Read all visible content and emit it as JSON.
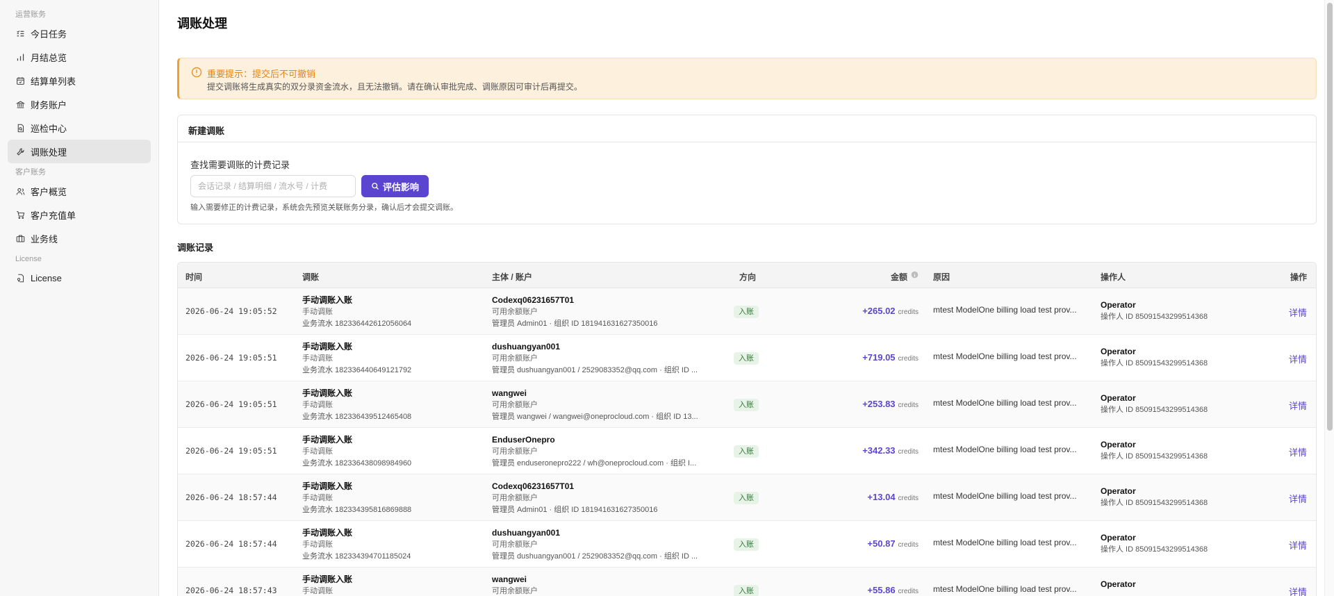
{
  "sidebar": {
    "groups": [
      {
        "label": "运营账务",
        "items": [
          {
            "label": "今日任务",
            "icon": "list-check-icon"
          },
          {
            "label": "月结总览",
            "icon": "bar-chart-icon"
          },
          {
            "label": "结算单列表",
            "icon": "calendar-icon"
          },
          {
            "label": "财务账户",
            "icon": "bank-icon"
          },
          {
            "label": "巡检中心",
            "icon": "file-search-icon"
          },
          {
            "label": "调账处理",
            "icon": "wrench-icon",
            "active": true
          }
        ]
      },
      {
        "label": "客户账务",
        "items": [
          {
            "label": "客户概览",
            "icon": "users-icon"
          },
          {
            "label": "客户充值单",
            "icon": "cart-icon"
          },
          {
            "label": "业务线",
            "icon": "briefcase-icon"
          }
        ]
      },
      {
        "label": "License",
        "items": [
          {
            "label": "License",
            "icon": "file-key-icon"
          }
        ]
      }
    ]
  },
  "page": {
    "title": "调账处理"
  },
  "warning": {
    "title": "重要提示：提交后不可撤销",
    "text": "提交调账将生成真实的双分录资金流水，且无法撤销。请在确认审批完成、调账原因可审计后再提交。"
  },
  "new_adjust": {
    "title": "新建调账",
    "label": "查找需要调账的计费记录",
    "placeholder": "会话记录 / 结算明细 / 流水号 / 计费",
    "button": "评估影响",
    "hint": "输入需要修正的计费记录，系统会先预览关联账务分录，确认后才会提交调账。"
  },
  "records": {
    "title": "调账记录",
    "columns": {
      "time": "时间",
      "adjust": "调账",
      "account": "主体 / 账户",
      "direction": "方向",
      "amount": "金额",
      "reason": "原因",
      "operator": "操作人",
      "action": "操作"
    },
    "rows": [
      {
        "time": "2026-06-24 19:05:52",
        "adj_title": "手动调账入账",
        "adj_type": "手动调账",
        "adj_flow": "业务流水 182336442612056064",
        "subject": "Codexq06231657T01",
        "account": "可用余额账户",
        "detail": "管理员 Admin01 · 组织 ID 181941631627350016",
        "direction": "入账",
        "amount": "+265.02",
        "unit": "credits",
        "reason": "mtest ModelOne billing load test prov...",
        "op_name": "Operator",
        "op_id": "操作人 ID 85091543299514368",
        "action": "详情"
      },
      {
        "time": "2026-06-24 19:05:51",
        "adj_title": "手动调账入账",
        "adj_type": "手动调账",
        "adj_flow": "业务流水 182336440649121792",
        "subject": "dushuangyan001",
        "account": "可用余额账户",
        "detail": "管理员 dushuangyan001 / 2529083352@qq.com · 组织 ID ...",
        "direction": "入账",
        "amount": "+719.05",
        "unit": "credits",
        "reason": "mtest ModelOne billing load test prov...",
        "op_name": "Operator",
        "op_id": "操作人 ID 85091543299514368",
        "action": "详情"
      },
      {
        "time": "2026-06-24 19:05:51",
        "adj_title": "手动调账入账",
        "adj_type": "手动调账",
        "adj_flow": "业务流水 182336439512465408",
        "subject": "wangwei",
        "account": "可用余额账户",
        "detail": "管理员 wangwei / wangwei@oneprocloud.com · 组织 ID 13...",
        "direction": "入账",
        "amount": "+253.83",
        "unit": "credits",
        "reason": "mtest ModelOne billing load test prov...",
        "op_name": "Operator",
        "op_id": "操作人 ID 85091543299514368",
        "action": "详情"
      },
      {
        "time": "2026-06-24 19:05:51",
        "adj_title": "手动调账入账",
        "adj_type": "手动调账",
        "adj_flow": "业务流水 182336438098984960",
        "subject": "EnduserOnepro",
        "account": "可用余额账户",
        "detail": "管理员 enduseronepro222 / wh@oneprocloud.com · 组织 I...",
        "direction": "入账",
        "amount": "+342.33",
        "unit": "credits",
        "reason": "mtest ModelOne billing load test prov...",
        "op_name": "Operator",
        "op_id": "操作人 ID 85091543299514368",
        "action": "详情"
      },
      {
        "time": "2026-06-24 18:57:44",
        "adj_title": "手动调账入账",
        "adj_type": "手动调账",
        "adj_flow": "业务流水 182334395816869888",
        "subject": "Codexq06231657T01",
        "account": "可用余额账户",
        "detail": "管理员 Admin01 · 组织 ID 181941631627350016",
        "direction": "入账",
        "amount": "+13.04",
        "unit": "credits",
        "reason": "mtest ModelOne billing load test prov...",
        "op_name": "Operator",
        "op_id": "操作人 ID 85091543299514368",
        "action": "详情"
      },
      {
        "time": "2026-06-24 18:57:44",
        "adj_title": "手动调账入账",
        "adj_type": "手动调账",
        "adj_flow": "业务流水 182334394701185024",
        "subject": "dushuangyan001",
        "account": "可用余额账户",
        "detail": "管理员 dushuangyan001 / 2529083352@qq.com · 组织 ID ...",
        "direction": "入账",
        "amount": "+50.87",
        "unit": "credits",
        "reason": "mtest ModelOne billing load test prov...",
        "op_name": "Operator",
        "op_id": "操作人 ID 85091543299514368",
        "action": "详情"
      },
      {
        "time": "2026-06-24 18:57:43",
        "adj_title": "手动调账入账",
        "adj_type": "手动调账",
        "adj_flow": "",
        "subject": "wangwei",
        "account": "可用余额账户",
        "detail": "",
        "direction": "入账",
        "amount": "+55.86",
        "unit": "credits",
        "reason": "mtest ModelOne billing load test prov...",
        "op_name": "Operator",
        "op_id": "",
        "action": "详情"
      }
    ]
  },
  "colors": {
    "accent": "#5b45d0",
    "warning": "#f0a030",
    "badge_bg": "#e8f3e8",
    "badge_text": "#2f7a35"
  }
}
